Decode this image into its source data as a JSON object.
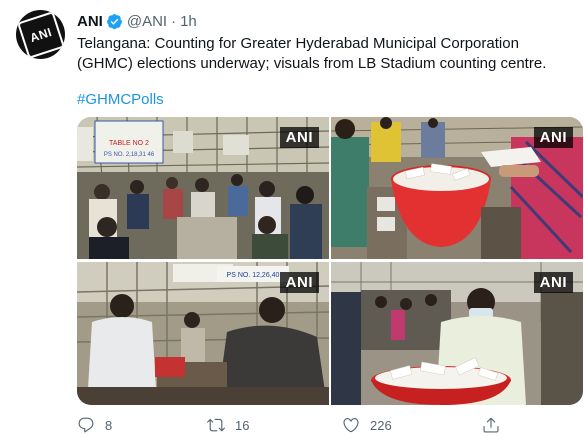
{
  "account": {
    "name": "ANI",
    "handle": "@ANI",
    "separator": "·",
    "time": "1h",
    "avatar_text": "ANI"
  },
  "tweet": {
    "text": "Telangana: Counting for Greater Hyderabad Municipal Corporation (GHMC) elections underway; visuals from LB Stadium counting centre.",
    "hashtag": "#GHMCPolls"
  },
  "media": {
    "watermark": "ANI",
    "photos": [
      {
        "label": "counting-hall-wide",
        "sign1": "TABLE NO 2",
        "sign2": "PS NO. 2,18,31 46"
      },
      {
        "label": "ballots-basket-1"
      },
      {
        "label": "officials-at-table",
        "sign1": "PS NO. 12,26,40"
      },
      {
        "label": "ballots-basket-2"
      }
    ]
  },
  "actions": {
    "reply_count": "8",
    "retweet_count": "16",
    "like_count": "226"
  },
  "colors": {
    "accent": "#1b95e0",
    "verified": "#1da1f2",
    "muted": "#536471"
  }
}
